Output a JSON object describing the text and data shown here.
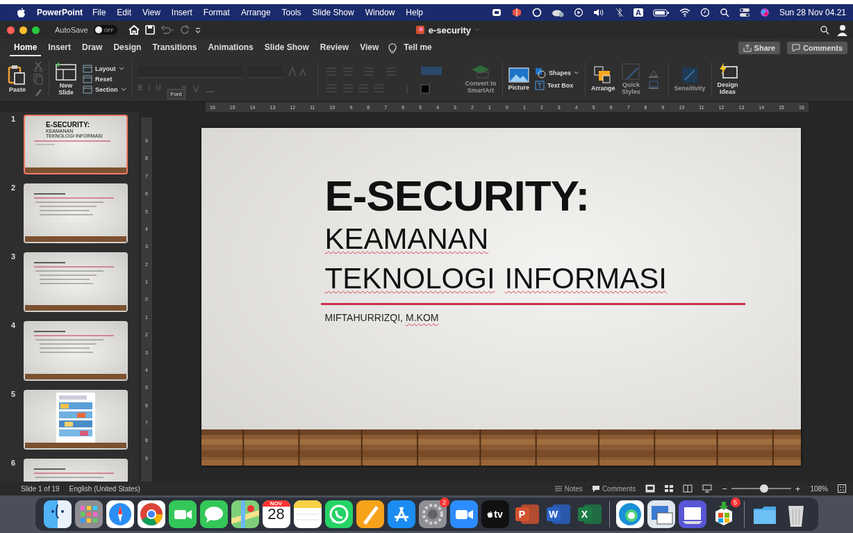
{
  "menu_bar": {
    "app": "PowerPoint",
    "items": [
      "File",
      "Edit",
      "View",
      "Insert",
      "Format",
      "Arrange",
      "Tools",
      "Slide Show",
      "Window",
      "Help"
    ],
    "input_source": "A",
    "clock": "Sun 28 Nov 04.21"
  },
  "title_bar": {
    "autosave_label": "AutoSave",
    "autosave": {
      "on": false,
      "label": "OFF"
    },
    "title": "e-security"
  },
  "tabs": [
    {
      "label": "Home",
      "selected": true
    },
    {
      "label": "Insert",
      "selected": false
    },
    {
      "label": "Draw",
      "selected": false
    },
    {
      "label": "Design",
      "selected": false
    },
    {
      "label": "Transitions",
      "selected": false
    },
    {
      "label": "Animations",
      "selected": false
    },
    {
      "label": "Slide Show",
      "selected": false
    },
    {
      "label": "Review",
      "selected": false
    },
    {
      "label": "View",
      "selected": false
    }
  ],
  "tell_me": "Tell me",
  "share": "Share",
  "comments_button": "Comments",
  "ribbon": {
    "paste": {
      "label": "Paste",
      "disabled": false
    },
    "new_slide": {
      "label": "New\nSlide",
      "disabled": false
    },
    "slide_options": [
      {
        "label": "Layout",
        "dropdown": true
      },
      {
        "label": "Reset",
        "dropdown": false
      },
      {
        "label": "Section",
        "dropdown": true
      }
    ],
    "format_letters": [
      {
        "label": "B",
        "disabled": true
      },
      {
        "label": "I",
        "disabled": true
      },
      {
        "label": "U",
        "disabled": true
      }
    ],
    "tooltip": "Font",
    "smartart": {
      "label": "Convert to\nSmartArt",
      "disabled": true
    },
    "picture": {
      "label": "Picture",
      "disabled": false
    },
    "shapes": {
      "label": "Shapes",
      "disabled": false
    },
    "text_box": {
      "label": "Text Box",
      "disabled": false
    },
    "arrange": {
      "label": "Arrange",
      "disabled": false
    },
    "quick_styles": {
      "label": "Quick\nStyles",
      "disabled": true
    },
    "sensitivity": {
      "label": "Sensitivity",
      "disabled": true
    },
    "design_ideas": {
      "label": "Design\nIdeas",
      "disabled": false
    }
  },
  "ruler_marks": [
    "16",
    "15",
    "14",
    "13",
    "12",
    "11",
    "10",
    "9",
    "8",
    "7",
    "6",
    "5",
    "4",
    "3",
    "2",
    "1",
    "0",
    "1",
    "2",
    "3",
    "4",
    "5",
    "6",
    "7",
    "8",
    "9",
    "10",
    "11",
    "12",
    "13",
    "14",
    "15",
    "16"
  ],
  "vertical_ruler_marks": [
    "9",
    "8",
    "7",
    "6",
    "5",
    "4",
    "3",
    "2",
    "1",
    "0",
    "1",
    "2",
    "3",
    "4",
    "5",
    "6",
    "7",
    "8",
    "9"
  ],
  "thumbnails": [
    {
      "number": "1",
      "selected": true,
      "kind": "title",
      "title": "E-SECURITY:",
      "subtitle": [
        "KEAMANAN",
        "TEKNOLOGI INFORMASI"
      ]
    },
    {
      "number": "2",
      "selected": false,
      "kind": "bullets"
    },
    {
      "number": "3",
      "selected": false,
      "kind": "bullets"
    },
    {
      "number": "4",
      "selected": false,
      "kind": "bullets"
    },
    {
      "number": "5",
      "selected": false,
      "kind": "picture"
    },
    {
      "number": "6",
      "selected": false,
      "kind": "bullets"
    }
  ],
  "slide": {
    "title": "E-SECURITY:",
    "subtitle_lines": [
      [
        {
          "word": "KEAMANAN",
          "misspelled": true
        }
      ],
      [
        {
          "word": "TEKNOLOGI",
          "misspelled": true
        },
        {
          "word": "INFORMASI",
          "misspelled": true
        }
      ]
    ],
    "author": [
      {
        "word": "MIFTAHURRIZQI,",
        "misspelled": false
      },
      {
        "word": "M.KOM",
        "misspelled": true
      }
    ]
  },
  "status_bar": {
    "slide_count": "Slide 1 of 19",
    "language": "English (United States)",
    "notes": "Notes",
    "comments": "Comments",
    "zoom": {
      "level": 0.55,
      "reading": "108%",
      "minus": "−",
      "plus": "+"
    }
  },
  "dock": [
    {
      "kind": "finder"
    },
    {
      "kind": "launchpad"
    },
    {
      "kind": "safari"
    },
    {
      "kind": "chrome"
    },
    {
      "kind": "facetime"
    },
    {
      "kind": "messages"
    },
    {
      "kind": "maps"
    },
    {
      "kind": "calendar",
      "month": "NOV",
      "day": "28"
    },
    {
      "kind": "notes"
    },
    {
      "kind": "whatsapp"
    },
    {
      "kind": "pages"
    },
    {
      "kind": "appstore"
    },
    {
      "kind": "settings",
      "badge": "2"
    },
    {
      "kind": "zoom"
    },
    {
      "kind": "tv",
      "text": "tv"
    },
    {
      "kind": "office",
      "text": "P",
      "color": "#d35230"
    },
    {
      "kind": "office",
      "text": "W",
      "color": "#2b62c4"
    },
    {
      "kind": "office",
      "text": "X",
      "color": "#1e7a45"
    },
    {
      "kind": "separator"
    },
    {
      "kind": "edge"
    },
    {
      "kind": "preview"
    },
    {
      "kind": "scanner"
    },
    {
      "kind": "installer",
      "badge": "5"
    },
    {
      "kind": "separator"
    },
    {
      "kind": "folder"
    },
    {
      "kind": "trash"
    }
  ]
}
